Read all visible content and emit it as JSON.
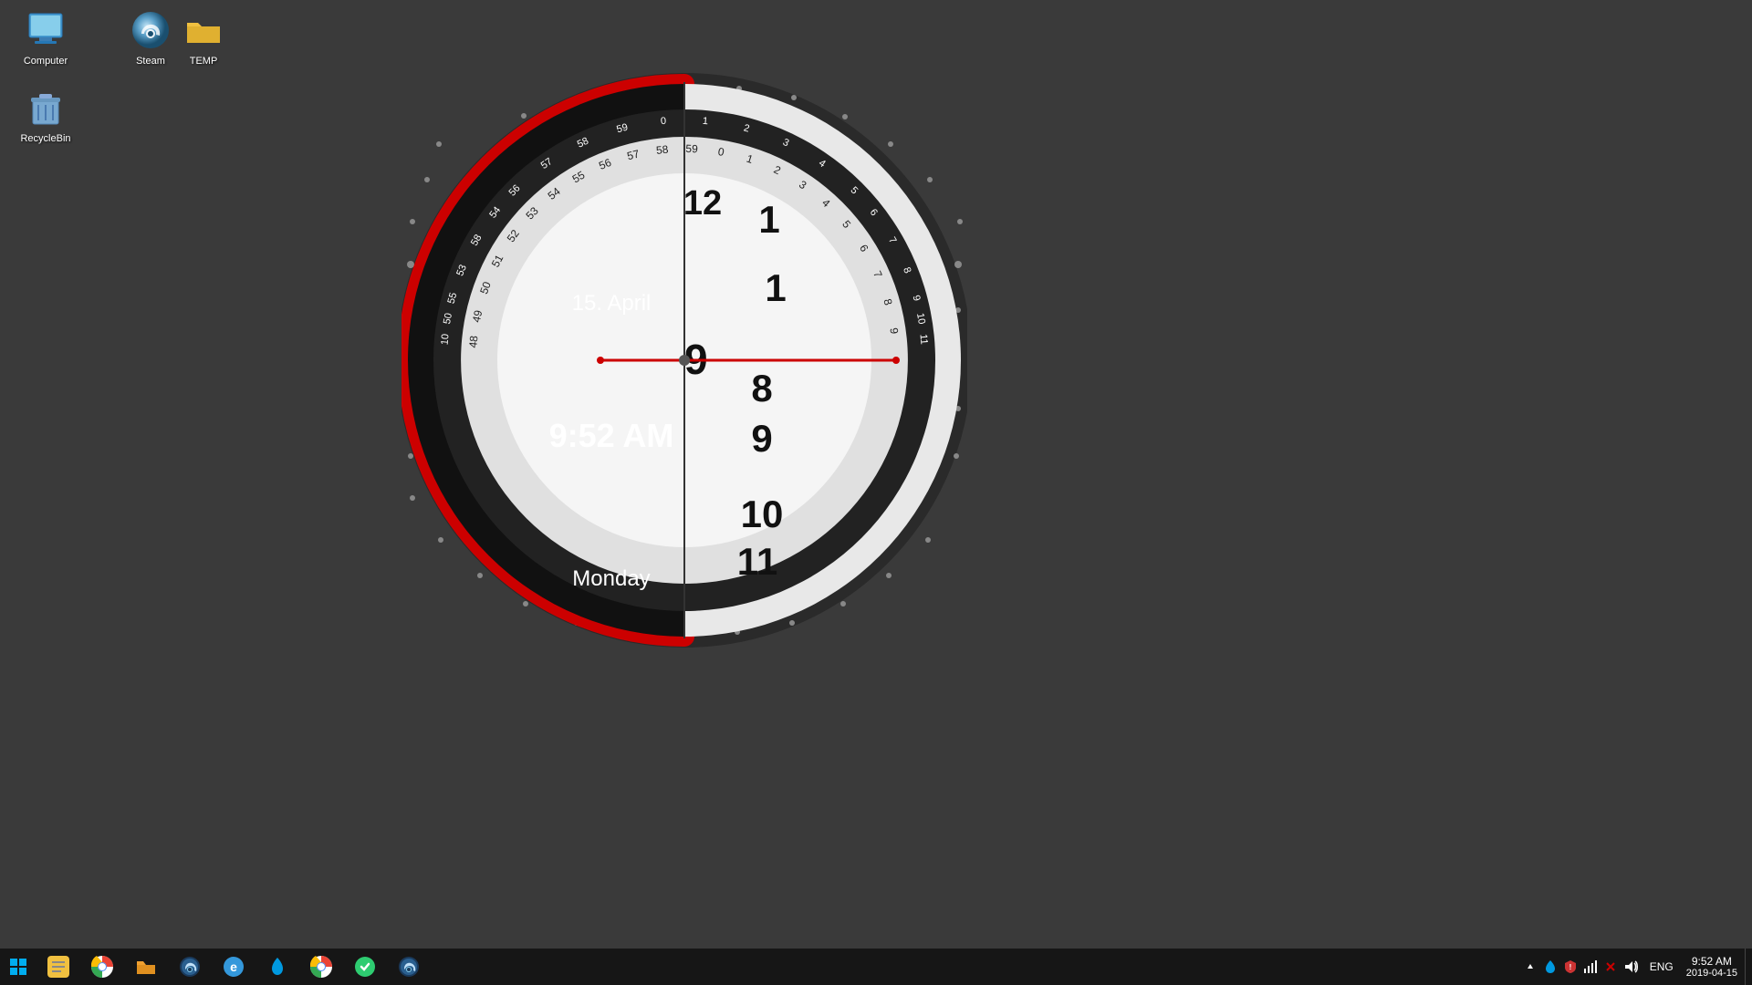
{
  "desktop": {
    "background_color": "#3a3a3a",
    "icons": [
      {
        "id": "computer",
        "label": "Computer",
        "type": "computer"
      },
      {
        "id": "recyclebin",
        "label": "RecycleBin",
        "type": "recycle"
      },
      {
        "id": "steam",
        "label": "Steam",
        "type": "steam"
      },
      {
        "id": "temp",
        "label": "TEMP",
        "type": "folder"
      }
    ]
  },
  "clock": {
    "time": "9:52 AM",
    "date": "15. April",
    "day": "Monday",
    "hour_number": 9,
    "minute_number": 52,
    "am_pm": "AM"
  },
  "taskbar": {
    "start_icon": "⊞",
    "icons": [
      {
        "id": "notes",
        "label": "Notes",
        "color": "#f0c040"
      },
      {
        "id": "chrome",
        "label": "Chrome",
        "color": "#4285f4"
      },
      {
        "id": "explorer",
        "label": "File Explorer",
        "color": "#f0a030"
      },
      {
        "id": "steam",
        "label": "Steam",
        "color": "#4a9fd4"
      },
      {
        "id": "edge",
        "label": "Edge",
        "color": "#3498db"
      },
      {
        "id": "dropbox",
        "label": "Dropbox",
        "color": "#0061fe"
      },
      {
        "id": "chrome2",
        "label": "Chrome",
        "color": "#4285f4"
      },
      {
        "id": "keepass",
        "label": "KeePass",
        "color": "#2ecc71"
      },
      {
        "id": "steam2",
        "label": "Steam",
        "color": "#4a9fd4"
      }
    ],
    "sys_area": {
      "time": "9:52 AM",
      "date": "2019-04-15",
      "language": "ENG"
    }
  }
}
